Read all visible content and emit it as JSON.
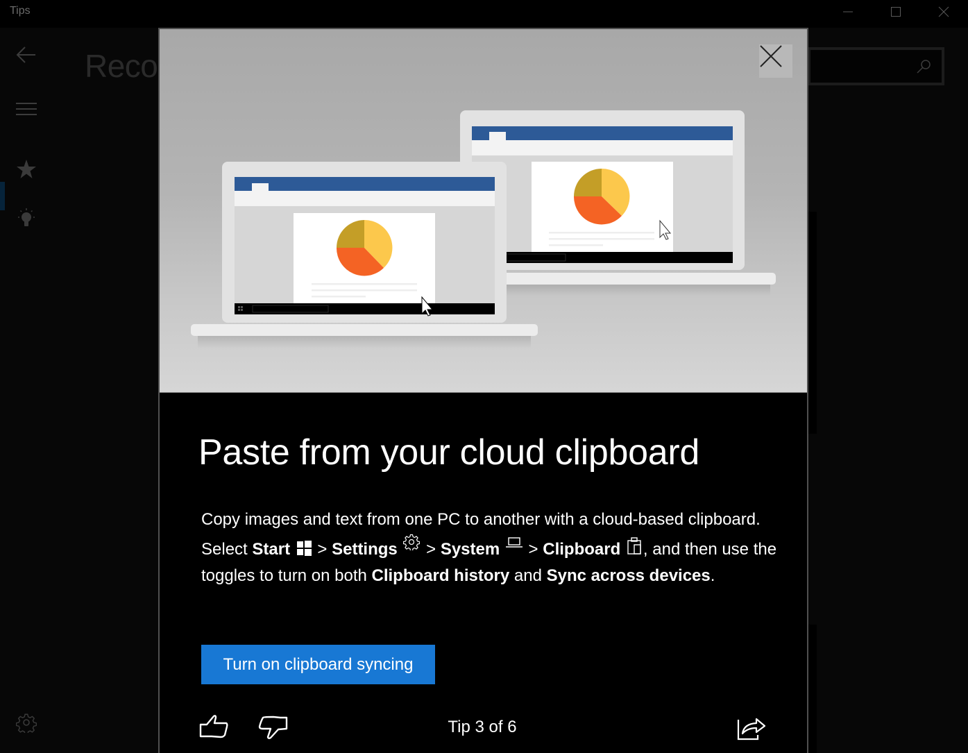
{
  "window": {
    "title": "Tips",
    "controls": {
      "minimize": "minimize-icon",
      "maximize": "maximize-icon",
      "close": "close-icon"
    }
  },
  "app": {
    "page_heading": "Reco",
    "search": {
      "placeholder": "",
      "value": "",
      "icon": "search-icon"
    },
    "sidebar": {
      "items": [
        {
          "name": "back",
          "icon": "back-arrow-icon"
        },
        {
          "name": "menu",
          "icon": "hamburger-icon"
        },
        {
          "name": "recommended",
          "icon": "star-icon",
          "selected": true
        },
        {
          "name": "tips",
          "icon": "lightbulb-icon"
        },
        {
          "name": "settings",
          "icon": "gear-icon"
        }
      ]
    }
  },
  "modal": {
    "close_icon": "close-icon",
    "hero": {
      "description": "Two laptops showing a document with a pie chart",
      "colors": {
        "window_bar": "#2d5a97",
        "pie_gold": "#c49e27",
        "pie_yellow": "#fcc84c",
        "pie_orange": "#f46324"
      }
    },
    "title": "Paste from your cloud clipboard",
    "body": {
      "line1": "Copy images and text from one PC to another with a cloud-based clipboard. Select ",
      "start": "Start",
      "sep": " > ",
      "settings": "Settings",
      "system": "System",
      "clipboard": "Clipboard",
      "after_clipboard": ", and then use the toggles to turn on both ",
      "clipboard_history": "Clipboard history",
      "and": " and ",
      "sync": "Sync across devices",
      "end": "."
    },
    "cta_label": "Turn on clipboard syncing",
    "footer": {
      "like_icon": "thumbs-up-icon",
      "dislike_icon": "thumbs-down-icon",
      "counter": "Tip 3 of 6",
      "current": 3,
      "total": 6,
      "share_icon": "share-icon"
    },
    "accent_color": "#1878d4"
  }
}
